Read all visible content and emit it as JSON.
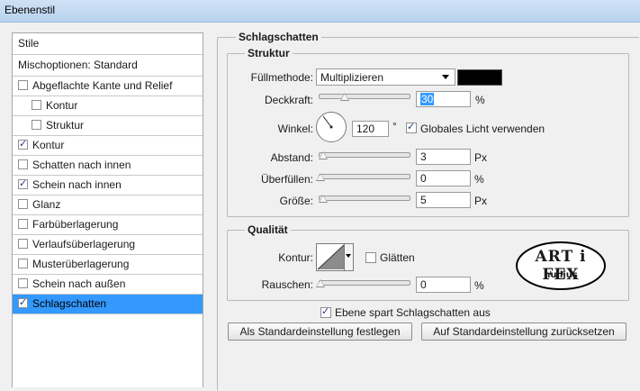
{
  "window": {
    "title": "Ebenenstil"
  },
  "sidebar": {
    "items": [
      {
        "label": "Stile"
      },
      {
        "label": "Mischoptionen: Standard"
      },
      {
        "label": "Abgeflachte Kante und Relief",
        "checked": false
      },
      {
        "label": "Kontur",
        "checked": false
      },
      {
        "label": "Struktur",
        "checked": false
      },
      {
        "label": "Kontur",
        "checked": true
      },
      {
        "label": "Schatten nach innen",
        "checked": false
      },
      {
        "label": "Schein nach innen",
        "checked": true
      },
      {
        "label": "Glanz",
        "checked": false
      },
      {
        "label": "Farbüberlagerung",
        "checked": false
      },
      {
        "label": "Verlaufsüberlagerung",
        "checked": false
      },
      {
        "label": "Musterüberlagerung",
        "checked": false
      },
      {
        "label": "Schein nach außen",
        "checked": false
      },
      {
        "label": "Schlagschatten",
        "checked": true,
        "selected": true
      }
    ]
  },
  "panel": {
    "title": "Schlagschatten",
    "struktur": {
      "title": "Struktur",
      "fuellmethode_label": "Füllmethode:",
      "fuellmethode_value": "Multiplizieren",
      "color": "#000000",
      "deckkraft_label": "Deckkraft:",
      "deckkraft_value": "30",
      "deckkraft_unit": "%",
      "deckkraft_fraction": 0.3,
      "winkel_label": "Winkel:",
      "winkel_value": "120",
      "winkel_unit": "°",
      "global_light_label": "Globales Licht verwenden",
      "global_light_checked": true,
      "abstand_label": "Abstand:",
      "abstand_value": "3",
      "abstand_unit": "Px",
      "ueberfuellen_label": "Überfüllen:",
      "ueberfuellen_value": "0",
      "ueberfuellen_unit": "%",
      "groesse_label": "Größe:",
      "groesse_value": "5",
      "groesse_unit": "Px"
    },
    "qualitaet": {
      "title": "Qualität",
      "kontur_label": "Kontur:",
      "glaetten_label": "Glätten",
      "glaetten_checked": false,
      "rauschen_label": "Rauschen:",
      "rauschen_value": "0",
      "rauschen_unit": "%",
      "logo_text_top": "ART i FEX",
      "logo_text_bottom": "nullius"
    },
    "ebene_spart_label": "Ebene spart Schlagschatten aus",
    "ebene_spart_checked": true,
    "btn_set_default": "Als Standardeinstellung festlegen",
    "btn_reset_default": "Auf Standardeinstellung zurücksetzen"
  }
}
